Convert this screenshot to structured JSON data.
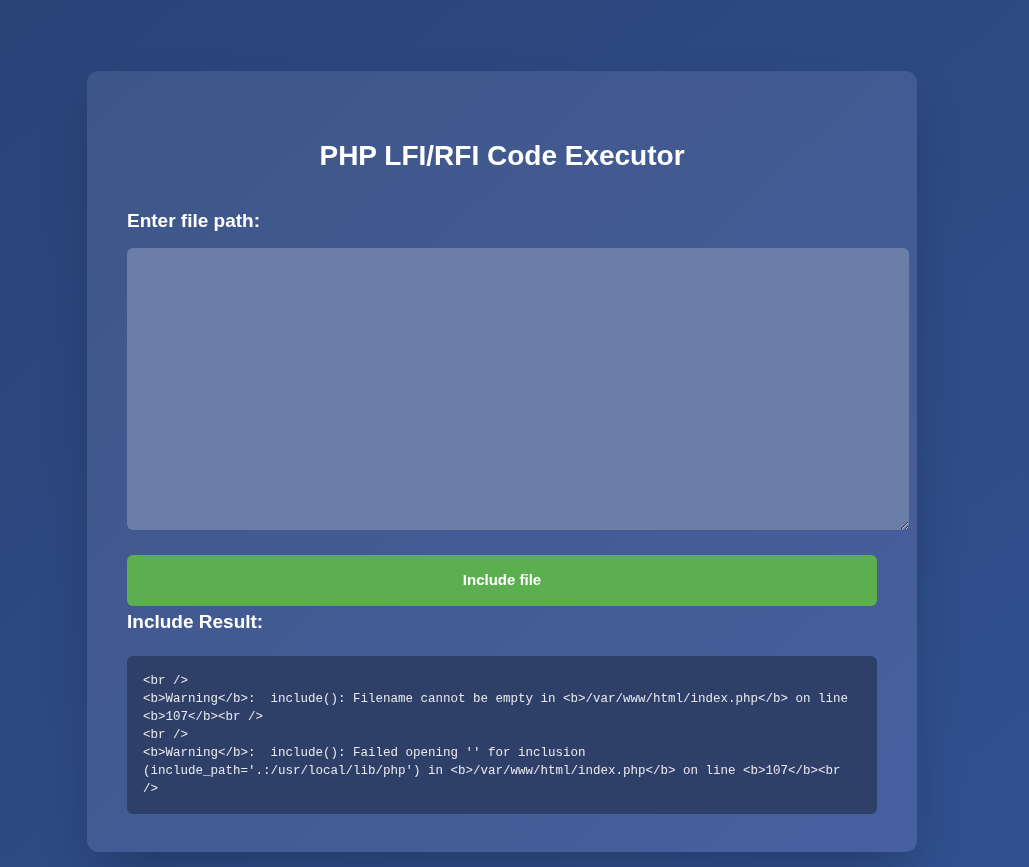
{
  "title": "PHP LFI/RFI Code Executor",
  "path_label": "Enter file path:",
  "submit_button": "Include file",
  "result_label": "Include Result:",
  "result_output": "<br />\n<b>Warning</b>:  include(): Filename cannot be empty in <b>/var/www/html/index.php</b> on line <b>107</b><br />\n<br />\n<b>Warning</b>:  include(): Failed opening '' for inclusion (include_path='.:/usr/local/lib/php') in <b>/var/www/html/index.php</b> on line <b>107</b><br />"
}
